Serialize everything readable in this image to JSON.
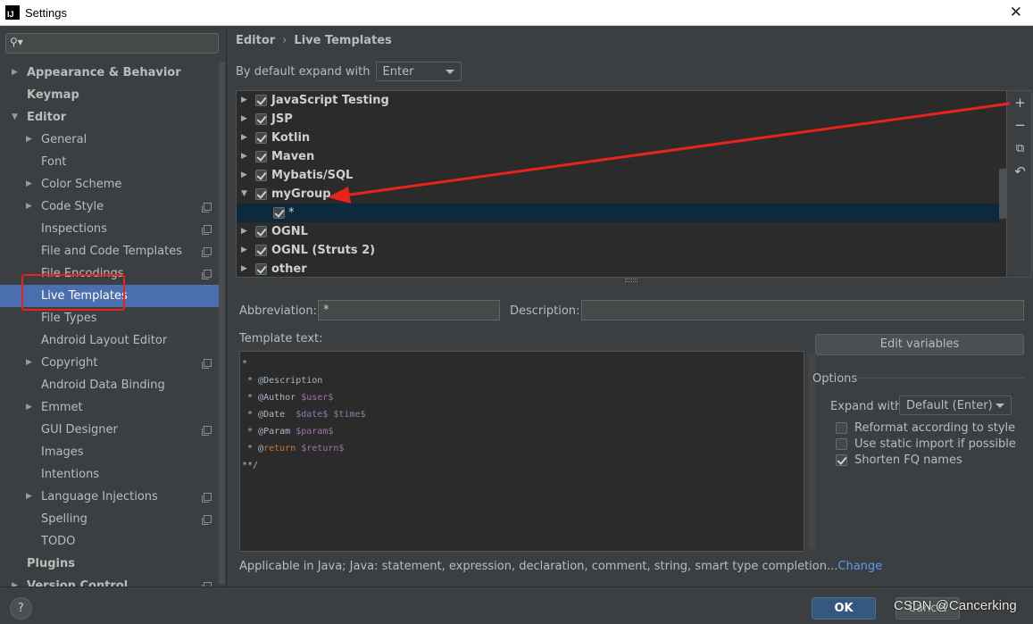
{
  "window": {
    "title": "Settings",
    "app_icon_text": "IJ"
  },
  "search": {
    "placeholder": "",
    "value": ""
  },
  "sidebar": {
    "items": [
      {
        "label": "Appearance & Behavior",
        "level": 0,
        "bold": true,
        "arrow": "right",
        "copy": false,
        "selected": false
      },
      {
        "label": "Keymap",
        "level": 0,
        "bold": true,
        "arrow": "",
        "copy": false,
        "selected": false
      },
      {
        "label": "Editor",
        "level": 0,
        "bold": true,
        "arrow": "down",
        "copy": false,
        "selected": false
      },
      {
        "label": "General",
        "level": 1,
        "bold": false,
        "arrow": "right",
        "copy": false,
        "selected": false
      },
      {
        "label": "Font",
        "level": 1,
        "bold": false,
        "arrow": "",
        "copy": false,
        "selected": false
      },
      {
        "label": "Color Scheme",
        "level": 1,
        "bold": false,
        "arrow": "right",
        "copy": false,
        "selected": false
      },
      {
        "label": "Code Style",
        "level": 1,
        "bold": false,
        "arrow": "right",
        "copy": true,
        "selected": false
      },
      {
        "label": "Inspections",
        "level": 1,
        "bold": false,
        "arrow": "",
        "copy": true,
        "selected": false
      },
      {
        "label": "File and Code Templates",
        "level": 1,
        "bold": false,
        "arrow": "",
        "copy": true,
        "selected": false
      },
      {
        "label": "File Encodings",
        "level": 1,
        "bold": false,
        "arrow": "",
        "copy": true,
        "selected": false
      },
      {
        "label": "Live Templates",
        "level": 1,
        "bold": false,
        "arrow": "",
        "copy": false,
        "selected": true
      },
      {
        "label": "File Types",
        "level": 1,
        "bold": false,
        "arrow": "",
        "copy": false,
        "selected": false
      },
      {
        "label": "Android Layout Editor",
        "level": 1,
        "bold": false,
        "arrow": "",
        "copy": false,
        "selected": false
      },
      {
        "label": "Copyright",
        "level": 1,
        "bold": false,
        "arrow": "right",
        "copy": true,
        "selected": false
      },
      {
        "label": "Android Data Binding",
        "level": 1,
        "bold": false,
        "arrow": "",
        "copy": false,
        "selected": false
      },
      {
        "label": "Emmet",
        "level": 1,
        "bold": false,
        "arrow": "right",
        "copy": false,
        "selected": false
      },
      {
        "label": "GUI Designer",
        "level": 1,
        "bold": false,
        "arrow": "",
        "copy": true,
        "selected": false
      },
      {
        "label": "Images",
        "level": 1,
        "bold": false,
        "arrow": "",
        "copy": false,
        "selected": false
      },
      {
        "label": "Intentions",
        "level": 1,
        "bold": false,
        "arrow": "",
        "copy": false,
        "selected": false
      },
      {
        "label": "Language Injections",
        "level": 1,
        "bold": false,
        "arrow": "right",
        "copy": true,
        "selected": false
      },
      {
        "label": "Spelling",
        "level": 1,
        "bold": false,
        "arrow": "",
        "copy": true,
        "selected": false
      },
      {
        "label": "TODO",
        "level": 1,
        "bold": false,
        "arrow": "",
        "copy": false,
        "selected": false
      },
      {
        "label": "Plugins",
        "level": 0,
        "bold": true,
        "arrow": "",
        "copy": false,
        "selected": false
      },
      {
        "label": "Version Control",
        "level": 0,
        "bold": true,
        "arrow": "right",
        "copy": true,
        "selected": false
      }
    ]
  },
  "breadcrumb": {
    "parent": "Editor",
    "separator": "›",
    "current": "Live Templates"
  },
  "expand_default": {
    "label": "By default expand with",
    "value": "Enter"
  },
  "template_groups": [
    {
      "name": "JavaScript Testing",
      "expanded": false,
      "checked": true,
      "child": false,
      "selected": false
    },
    {
      "name": "JSP",
      "expanded": false,
      "checked": true,
      "child": false,
      "selected": false
    },
    {
      "name": "Kotlin",
      "expanded": false,
      "checked": true,
      "child": false,
      "selected": false
    },
    {
      "name": "Maven",
      "expanded": false,
      "checked": true,
      "child": false,
      "selected": false
    },
    {
      "name": "Mybatis/SQL",
      "expanded": false,
      "checked": true,
      "child": false,
      "selected": false
    },
    {
      "name": "myGroup",
      "expanded": true,
      "checked": true,
      "child": false,
      "selected": false
    },
    {
      "name": "*",
      "expanded": false,
      "checked": true,
      "child": true,
      "selected": true
    },
    {
      "name": "OGNL",
      "expanded": false,
      "checked": true,
      "child": false,
      "selected": false
    },
    {
      "name": "OGNL (Struts 2)",
      "expanded": false,
      "checked": true,
      "child": false,
      "selected": false
    },
    {
      "name": "other",
      "expanded": false,
      "checked": true,
      "child": false,
      "selected": false
    }
  ],
  "toolbar": {
    "add": "+",
    "remove": "−",
    "copy": "⧉",
    "restore": "↶"
  },
  "abbreviation": {
    "label": "Abbreviation:",
    "value": "*"
  },
  "description": {
    "label": "Description:",
    "value": ""
  },
  "template_text": {
    "label": "Template text:",
    "lines": [
      [
        {
          "t": "*",
          "c": ""
        }
      ],
      [
        {
          "t": " * @Description",
          "c": ""
        }
      ],
      [
        {
          "t": " * @Author ",
          "c": ""
        },
        {
          "t": "$user$",
          "c": "var"
        }
      ],
      [
        {
          "t": " * @Date  ",
          "c": ""
        },
        {
          "t": "$date$",
          "c": "var"
        },
        {
          "t": " ",
          "c": ""
        },
        {
          "t": "$time$",
          "c": "var"
        }
      ],
      [
        {
          "t": " * @Param ",
          "c": ""
        },
        {
          "t": "$param$",
          "c": "var"
        }
      ],
      [
        {
          "t": " * @",
          "c": ""
        },
        {
          "t": "return",
          "c": "kw"
        },
        {
          "t": " ",
          "c": ""
        },
        {
          "t": "$return$",
          "c": "var"
        }
      ],
      [
        {
          "t": "**/",
          "c": ""
        }
      ]
    ]
  },
  "edit_variables": {
    "label": "Edit variables"
  },
  "options": {
    "title": "Options",
    "expand_with_label": "Expand with",
    "expand_with_value": "Default (Enter)",
    "checkboxes": [
      {
        "label": "Reformat according to style",
        "checked": false
      },
      {
        "label": "Use static import if possible",
        "checked": false
      },
      {
        "label": "Shorten FQ names",
        "checked": true
      }
    ]
  },
  "applicable": {
    "text": "Applicable in Java; Java: statement, expression, declaration, comment, string, smart type completion...",
    "link": "Change"
  },
  "footer": {
    "help": "?",
    "ok": "OK",
    "cancel": "Cancel"
  },
  "watermark": "CSDN @Cancerking",
  "colors": {
    "annotation": "#e8231d",
    "selection": "#4b6eaf",
    "accent_link": "#589df6"
  }
}
